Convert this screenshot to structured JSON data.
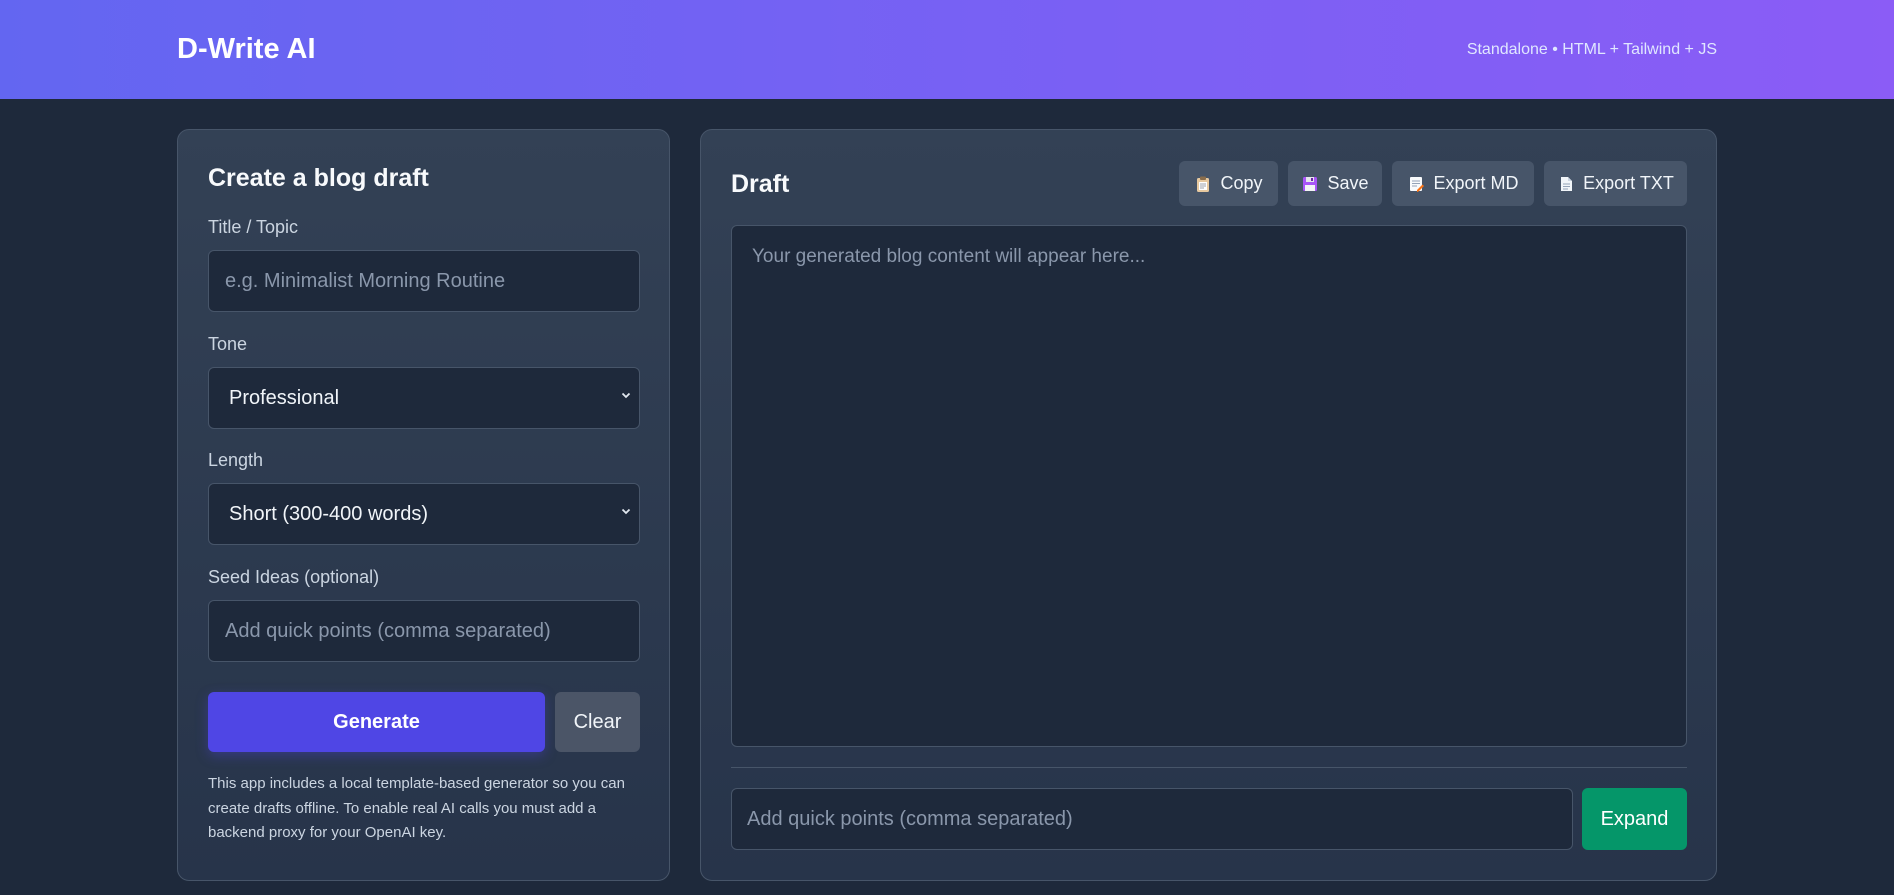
{
  "header": {
    "brand": "D-Write AI",
    "subtitle": "Standalone • HTML + Tailwind + JS"
  },
  "form": {
    "title": "Create a blog draft",
    "topic_label": "Title / Topic",
    "topic_placeholder": "e.g. Minimalist Morning Routine",
    "tone_label": "Tone",
    "tone_value": "Professional",
    "length_label": "Length",
    "length_value": "Short (300-400 words)",
    "seed_label": "Seed Ideas (optional)",
    "seed_placeholder": "Add quick points (comma separated)",
    "generate_label": "Generate",
    "clear_label": "Clear",
    "note": "This app includes a local template-based generator so you can create drafts offline. To enable real AI calls you must add a backend proxy for your OpenAI key."
  },
  "draft": {
    "title": "Draft",
    "buttons": {
      "copy": "Copy",
      "save": "Save",
      "export_md": "Export MD",
      "export_txt": "Export TXT"
    },
    "placeholder": "Your generated blog content will appear here...",
    "expand_placeholder": "Add quick points (comma separated)",
    "expand_label": "Expand"
  },
  "icons": {
    "copy": "clipboard-icon",
    "save": "floppy-disk-icon",
    "export_md": "memo-icon",
    "export_txt": "page-icon",
    "select": "chevron-down-icon"
  },
  "colors": {
    "header_start": "#6366f1",
    "header_end": "#8b5cf6",
    "primary": "#4f46e5",
    "expand": "#059669",
    "background": "#1e293b"
  }
}
